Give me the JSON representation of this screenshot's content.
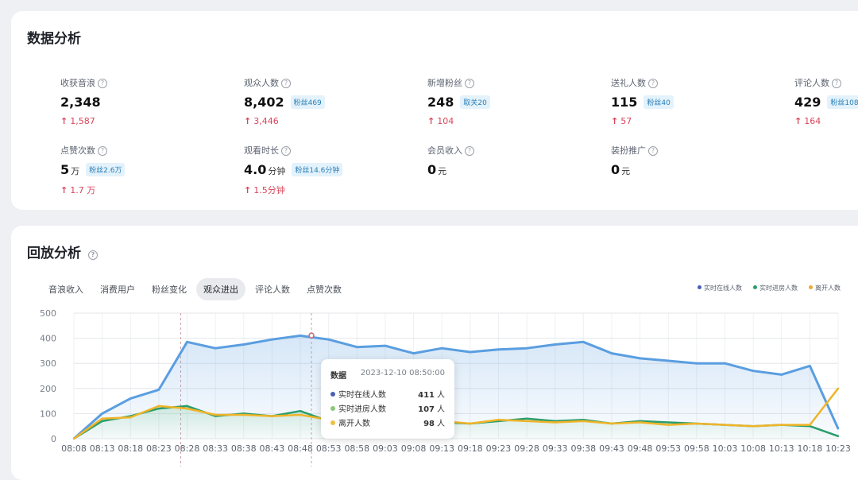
{
  "data_card": {
    "title": "数据分析",
    "metrics": [
      {
        "label": "收获音浪",
        "value": "2,348",
        "unit": "",
        "badge": "",
        "delta": "1,587"
      },
      {
        "label": "观众人数",
        "value": "8,402",
        "unit": "",
        "badge": "粉丝469",
        "delta": "3,446"
      },
      {
        "label": "新增粉丝",
        "value": "248",
        "unit": "",
        "badge": "取关20",
        "delta": "104"
      },
      {
        "label": "送礼人数",
        "value": "115",
        "unit": "",
        "badge": "粉丝40",
        "delta": "57"
      },
      {
        "label": "评论人数",
        "value": "429",
        "unit": "",
        "badge": "粉丝108",
        "delta": "164"
      },
      {
        "label": "点赞次数",
        "value": "5",
        "unit": "万",
        "badge": "粉丝2.6万",
        "delta": "1.7 万"
      },
      {
        "label": "观看时长",
        "value": "4.0",
        "unit": "分钟",
        "badge": "粉丝14.6分钟",
        "delta": "1.5分钟"
      },
      {
        "label": "会员收入",
        "value": "0",
        "unit": "元",
        "badge": "",
        "delta": ""
      },
      {
        "label": "装扮推广",
        "value": "0",
        "unit": "元",
        "badge": "",
        "delta": ""
      }
    ]
  },
  "replay_card": {
    "title": "回放分析",
    "tabs": [
      "音浪收入",
      "消费用户",
      "粉丝变化",
      "观众进出",
      "评论人数",
      "点赞次数"
    ],
    "active_tab": "观众进出",
    "legend": [
      {
        "name": "实时在线人数",
        "color": "#4a5fb4"
      },
      {
        "name": "实时进房人数",
        "color": "#2a9d6a"
      },
      {
        "name": "离开人数",
        "color": "#f0a830"
      }
    ]
  },
  "tooltip": {
    "title": "数据",
    "time": "2023-12-10 08:50:00",
    "rows": [
      {
        "name": "实时在线人数",
        "value": "411",
        "unit": "人",
        "color": "#4a5fb4"
      },
      {
        "name": "实时进房人数",
        "value": "107",
        "unit": "人",
        "color": "#8bc87a"
      },
      {
        "name": "离开人数",
        "value": "98",
        "unit": "人",
        "color": "#f0c040"
      }
    ]
  },
  "chart_data": {
    "type": "line",
    "x": [
      "08:08",
      "08:13",
      "08:18",
      "08:23",
      "08:28",
      "08:33",
      "08:38",
      "08:43",
      "08:48",
      "08:53",
      "08:58",
      "09:03",
      "09:08",
      "09:13",
      "09:18",
      "09:23",
      "09:28",
      "09:33",
      "09:38",
      "09:43",
      "09:48",
      "09:53",
      "09:58",
      "10:03",
      "10:08",
      "10:13",
      "10:18",
      "10:23"
    ],
    "ylim": [
      0,
      500
    ],
    "yticks": [
      0,
      100,
      200,
      300,
      400,
      500
    ],
    "series": [
      {
        "name": "实时在线人数",
        "color": "#5a9ee0",
        "values": [
          0,
          100,
          160,
          195,
          385,
          360,
          375,
          395,
          410,
          395,
          365,
          370,
          340,
          360,
          345,
          355,
          360,
          375,
          385,
          340,
          320,
          310,
          300,
          300,
          270,
          255,
          290,
          40
        ]
      },
      {
        "name": "实时进房人数",
        "color": "#2a9d6a",
        "values": [
          0,
          70,
          90,
          120,
          130,
          90,
          100,
          90,
          110,
          70,
          75,
          70,
          70,
          65,
          60,
          70,
          80,
          70,
          75,
          60,
          70,
          65,
          60,
          55,
          50,
          55,
          50,
          10
        ]
      },
      {
        "name": "离开人数",
        "color": "#f0b429",
        "values": [
          0,
          80,
          85,
          130,
          120,
          95,
          95,
          90,
          95,
          75,
          70,
          75,
          65,
          70,
          60,
          75,
          70,
          65,
          70,
          60,
          65,
          55,
          60,
          55,
          50,
          55,
          55,
          200
        ]
      }
    ]
  }
}
